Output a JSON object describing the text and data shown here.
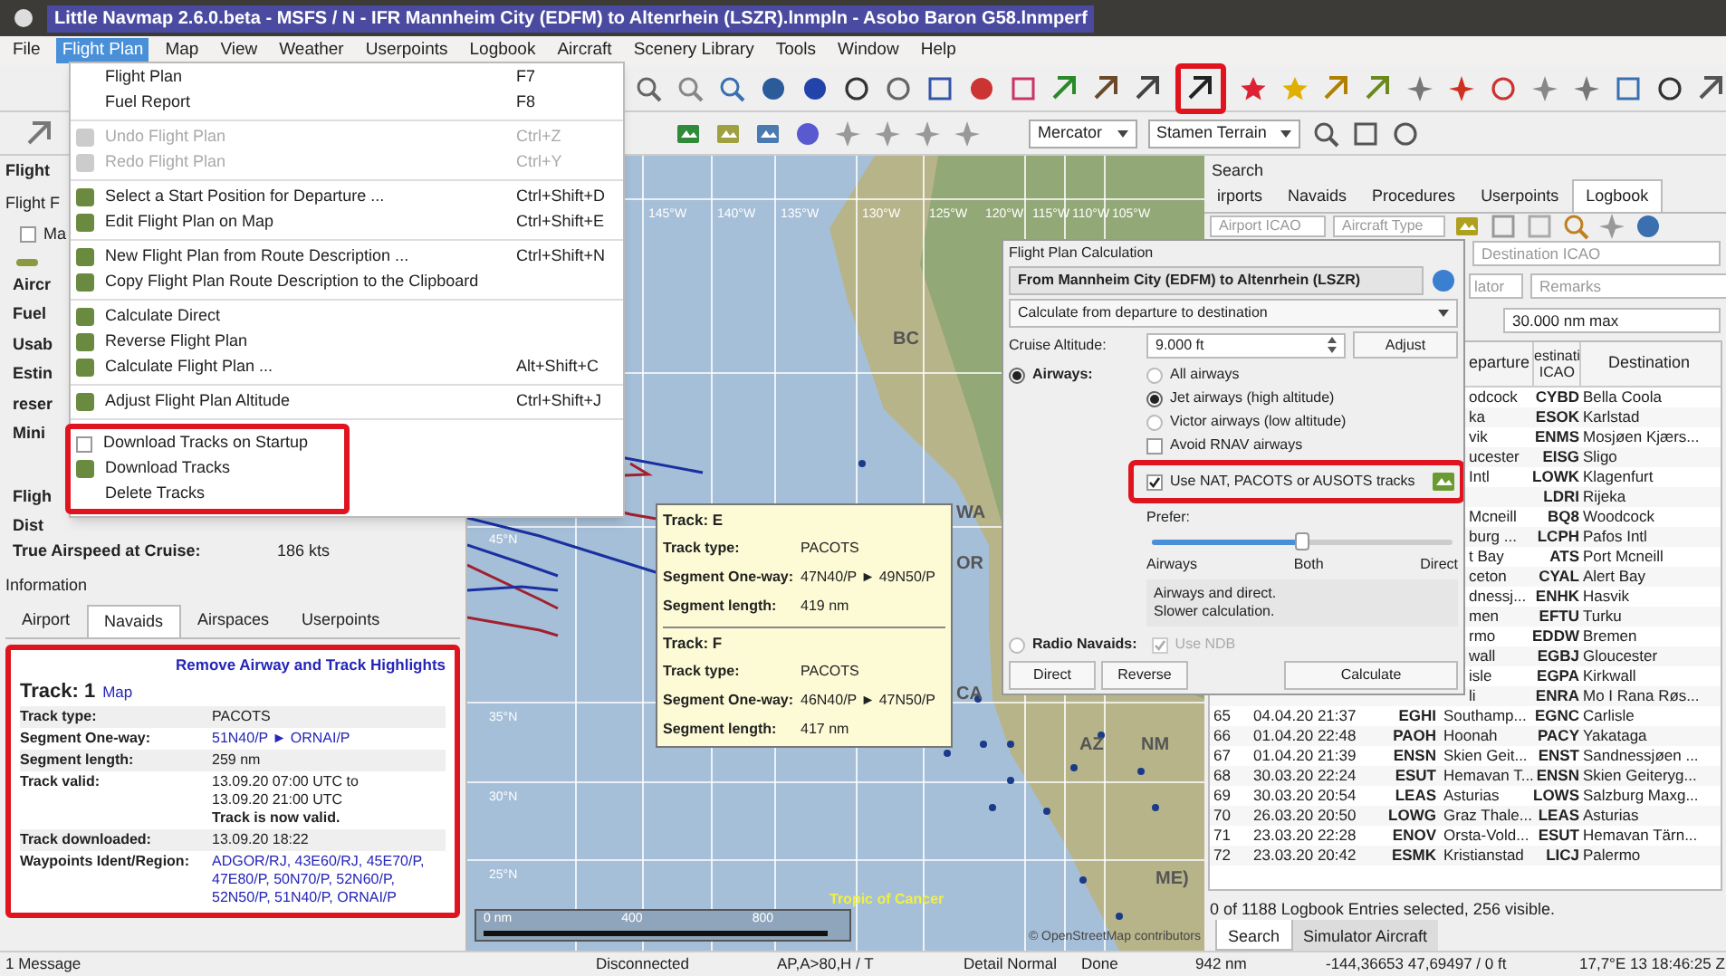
{
  "title_bar": {
    "title": "Little Navmap 2.6.0.beta - MSFS / N - IFR Mannheim City (EDFM) to Altenrhein (LSZR).lnmpln - Asobo Baron G58.lnmperf"
  },
  "menu_bar": [
    {
      "label": "File",
      "selected": false
    },
    {
      "label": "Flight Plan",
      "selected": true
    },
    {
      "label": "Map",
      "selected": false
    },
    {
      "label": "View",
      "selected": false
    },
    {
      "label": "Weather",
      "selected": false
    },
    {
      "label": "Userpoints",
      "selected": false
    },
    {
      "label": "Logbook",
      "selected": false
    },
    {
      "label": "Aircraft",
      "selected": false
    },
    {
      "label": "Scenery Library",
      "selected": false
    },
    {
      "label": "Tools",
      "selected": false
    },
    {
      "label": "Window",
      "selected": false
    },
    {
      "label": "Help",
      "selected": false
    }
  ],
  "flight_plan_menu": [
    {
      "kind": "item",
      "label": "Flight Plan",
      "shortcut": "F7",
      "disabled": false
    },
    {
      "kind": "item",
      "label": "Fuel Report",
      "shortcut": "F8",
      "disabled": false
    },
    {
      "kind": "separator"
    },
    {
      "kind": "item",
      "label": "Undo Flight Plan",
      "shortcut": "Ctrl+Z",
      "disabled": true
    },
    {
      "kind": "item",
      "label": "Redo Flight Plan",
      "shortcut": "Ctrl+Y",
      "disabled": true
    },
    {
      "kind": "separator"
    },
    {
      "kind": "item",
      "label": "Select a Start Position for Departure ...",
      "shortcut": "Ctrl+Shift+D",
      "disabled": false
    },
    {
      "kind": "item",
      "label": "Edit Flight Plan on Map",
      "shortcut": "Ctrl+Shift+E",
      "disabled": false
    },
    {
      "kind": "separator"
    },
    {
      "kind": "item",
      "label": "New Flight Plan from Route Description ...",
      "shortcut": "Ctrl+Shift+N",
      "disabled": false
    },
    {
      "kind": "item",
      "label": "Copy Flight Plan Route Description to the Clipboard",
      "disabled": false
    },
    {
      "kind": "separator"
    },
    {
      "kind": "item",
      "label": "Calculate Direct",
      "disabled": false
    },
    {
      "kind": "item",
      "label": "Reverse Flight Plan",
      "disabled": false
    },
    {
      "kind": "item",
      "label": "Calculate Flight Plan ...",
      "shortcut": "Alt+Shift+C",
      "disabled": false
    },
    {
      "kind": "separator"
    },
    {
      "kind": "item",
      "label": "Adjust Flight Plan Altitude",
      "shortcut": "Ctrl+Shift+J",
      "disabled": false
    },
    {
      "kind": "separator"
    },
    {
      "kind": "check",
      "label": "Download Tracks on Startup",
      "checked": false,
      "disabled": false
    },
    {
      "kind": "item",
      "label": "Download Tracks",
      "disabled": false
    },
    {
      "kind": "item",
      "label": "Delete Tracks",
      "disabled": false
    }
  ],
  "map_toolbar": {
    "projection": "Mercator",
    "theme": "Stamen Terrain"
  },
  "flight_plan_panel": {
    "dock_title": "Flight",
    "tab": "Flight F",
    "checkbox": {
      "label": "Ma",
      "checked": false
    },
    "cut_labels": [
      "Aircr",
      "Fuel",
      "Usab",
      "Estin",
      "reser",
      "Mini",
      "Fligh",
      "Dist"
    ],
    "rows": [
      {
        "label": "True Airspeed at Cruise:",
        "value": "186 kts"
      }
    ]
  },
  "information": {
    "title": "Information",
    "tabs": [
      {
        "label": "Airport",
        "selected": false
      },
      {
        "label": "Navaids",
        "selected": true
      },
      {
        "label": "Airspaces",
        "selected": false
      },
      {
        "label": "Userpoints",
        "selected": false
      }
    ],
    "remove_link": "Remove Airway and Track Highlights",
    "heading": "Track: 1",
    "map_link": "Map",
    "rows": [
      {
        "label": "Track type:",
        "value": "PACOTS",
        "link": false
      },
      {
        "label": "Segment One-way:",
        "value": "51N40/P ► ORNAI/P",
        "link": true
      },
      {
        "label": "Segment length:",
        "value": "259 nm",
        "link": false
      },
      {
        "label": "Track valid:",
        "value": "13.09.20 07:00 UTC to\n13.09.20 21:00 UTC\n**Track is now valid.**",
        "link": false
      },
      {
        "label": "Track downloaded:",
        "value": "13.09.20 18:22",
        "link": false
      },
      {
        "label": "Waypoints Ident/Region:",
        "value": "ADGOR/RJ, 43E60/RJ, 45E70/P, 47E80/P, 50N70/P, 52N60/P, 52N50/P, 51N40/P, ORNAI/P",
        "link": true
      }
    ]
  },
  "map": {
    "labels": [
      "145°W",
      "140°W",
      "135°W",
      "130°W",
      "125°W",
      "120°W",
      "115°W",
      "110°W",
      "105°W",
      "45°N",
      "35°N",
      "30°N",
      "25°N",
      "BC",
      "WA",
      "OR",
      "CA",
      "AZ",
      "NM",
      "ME)",
      "Tropic of Cancer"
    ],
    "scale": [
      "0 nm",
      "400",
      "800"
    ],
    "attribution": "© OpenStreetMap contributors"
  },
  "tooltip": {
    "tracks": [
      {
        "title": "Track: E",
        "rows": [
          {
            "label": "Track type:",
            "value": "PACOTS"
          },
          {
            "label": "Segment One-way:",
            "value": "47N40/P ► 49N50/P"
          },
          {
            "label": "Segment length:",
            "value": "419 nm"
          }
        ]
      },
      {
        "title": "Track: F",
        "rows": [
          {
            "label": "Track type:",
            "value": "PACOTS"
          },
          {
            "label": "Segment One-way:",
            "value": "46N40/P ► 47N50/P"
          },
          {
            "label": "Segment length:",
            "value": "417 nm"
          }
        ]
      }
    ]
  },
  "dialog": {
    "title": "Flight Plan Calculation",
    "route": "From Mannheim City (EDFM) to Altenrhein (LSZR)",
    "mode": "Calculate from departure to destination",
    "altitude_label": "Cruise Altitude:",
    "altitude": "9.000 ft",
    "adjust": "Adjust",
    "airways": {
      "label": "Airways:",
      "selected": true
    },
    "airway_options": [
      {
        "label": "All airways",
        "selected": false
      },
      {
        "label": "Jet airways (high altitude)",
        "selected": true
      },
      {
        "label": "Victor airways (low altitude)",
        "selected": false
      }
    ],
    "avoid_rnav": {
      "label": "Avoid RNAV airways",
      "checked": false
    },
    "use_tracks": {
      "label": "Use NAT, PACOTS or AUSOTS tracks",
      "checked": true
    },
    "prefer": {
      "label": "Prefer:",
      "level": 0.5,
      "ticks": [
        "Airways",
        "Both",
        "Direct"
      ]
    },
    "description": "Airways and direct.\nSlower calculation.",
    "radio_navaids": {
      "label": "Radio Navaids:",
      "selected": false
    },
    "use_ndb": {
      "label": "Use NDB",
      "checked": true,
      "disabled": true
    },
    "buttons": [
      "Direct",
      "Reverse",
      "Calculate"
    ]
  },
  "search": {
    "title": "Search",
    "tabs": [
      {
        "label": "irports",
        "selected": false
      },
      {
        "label": "Navaids",
        "selected": false
      },
      {
        "label": "Procedures",
        "selected": false
      },
      {
        "label": "Userpoints",
        "selected": false
      },
      {
        "label": "Logbook",
        "selected": true
      }
    ],
    "fields": {
      "airport": {
        "placeholder": "Airport ICAO"
      },
      "aircraft": {
        "placeholder": "Aircraft Type"
      },
      "destination": {
        "placeholder": "Destination ICAO"
      },
      "column_3": {
        "placeholder": "lator"
      },
      "remarks": {
        "placeholder": "Remarks"
      },
      "distance": {
        "value": "30.000 nm max"
      }
    },
    "columns": [
      "eparture",
      "estinati ICAO",
      "Destination"
    ],
    "rows": [
      {
        "departure": "odcock",
        "dest_icao": "CYBD",
        "destination": "Bella Coola"
      },
      {
        "departure": "ka",
        "dest_icao": "ESOK",
        "destination": "Karlstad"
      },
      {
        "departure": "vik",
        "dest_icao": "ENMS",
        "destination": "Mosjøen Kjærs..."
      },
      {
        "departure": "ucester",
        "dest_icao": "EISG",
        "destination": "Sligo"
      },
      {
        "departure": "Intl",
        "dest_icao": "LOWK",
        "destination": "Klagenfurt"
      },
      {
        "dest_icao": "LDRI",
        "destination": "Rijeka"
      },
      {
        "departure": "Mcneill",
        "dest_icao": "BQ8",
        "destination": "Woodcock"
      },
      {
        "departure": "burg ...",
        "dest_icao": "LCPH",
        "destination": "Pafos Intl"
      },
      {
        "departure": "t Bay",
        "dest_icao": "ATS",
        "destination": "Port Mcneill"
      },
      {
        "departure": "ceton",
        "dest_icao": "CYAL",
        "destination": "Alert Bay"
      },
      {
        "departure": "dnessj...",
        "dest_icao": "ENHK",
        "destination": "Hasvik"
      },
      {
        "departure": "men",
        "dest_icao": "EFTU",
        "destination": "Turku"
      },
      {
        "departure": "rmo",
        "dest_icao": "EDDW",
        "destination": "Bremen"
      },
      {
        "departure": "wall",
        "dest_icao": "EGBJ",
        "destination": "Gloucester"
      },
      {
        "departure": "isle",
        "dest_icao": "EGPA",
        "destination": "Kirkwall"
      },
      {
        "departure": "li",
        "dest_icao": "ENRA",
        "destination": "Mo I Rana Røs..."
      },
      {
        "num": "65",
        "date": "04.04.20 21:37",
        "dep_icao": "EGHI",
        "departure": "Southamp...",
        "dest_icao": "EGNC",
        "destination": "Carlisle"
      },
      {
        "num": "66",
        "date": "01.04.20 22:48",
        "dep_icao": "PAOH",
        "departure": "Hoonah",
        "dest_icao": "PACY",
        "destination": "Yakataga"
      },
      {
        "num": "67",
        "date": "01.04.20 21:39",
        "dep_icao": "ENSN",
        "departure": "Skien Geit...",
        "dest_icao": "ENST",
        "destination": "Sandnessjøen ..."
      },
      {
        "num": "68",
        "date": "30.03.20 22:24",
        "dep_icao": "ESUT",
        "departure": "Hemavan T...",
        "dest_icao": "ENSN",
        "destination": "Skien Geiteryg..."
      },
      {
        "num": "69",
        "date": "30.03.20 20:54",
        "dep_icao": "LEAS",
        "departure": "Asturias",
        "dest_icao": "LOWS",
        "destination": "Salzburg Maxg..."
      },
      {
        "num": "70",
        "date": "26.03.20 20:50",
        "dep_icao": "LOWG",
        "departure": "Graz Thale...",
        "dest_icao": "LEAS",
        "destination": "Asturias"
      },
      {
        "num": "71",
        "date": "23.03.20 22:28",
        "dep_icao": "ENOV",
        "departure": "Orsta-Vold...",
        "dest_icao": "ESUT",
        "destination": "Hemavan Tärn..."
      },
      {
        "num": "72",
        "date": "23.03.20 20:42",
        "dep_icao": "ESMK",
        "departure": "Kristianstad",
        "dest_icao": "LICJ",
        "destination": "Palermo"
      }
    ],
    "status": "0 of 1188 Logbook Entries selected, 256 visible.",
    "bottom_tabs": [
      {
        "label": "Search",
        "selected": true
      },
      {
        "label": "Simulator Aircraft",
        "selected": false
      }
    ]
  },
  "status_bar": [
    "1 Message",
    "Disconnected",
    "AP,A>80,H / T",
    "Detail Normal",
    "Done",
    "942 nm",
    "-144,36653 47,69497 / 0 ft",
    "17,7°E 13 18:46:25 Z"
  ]
}
